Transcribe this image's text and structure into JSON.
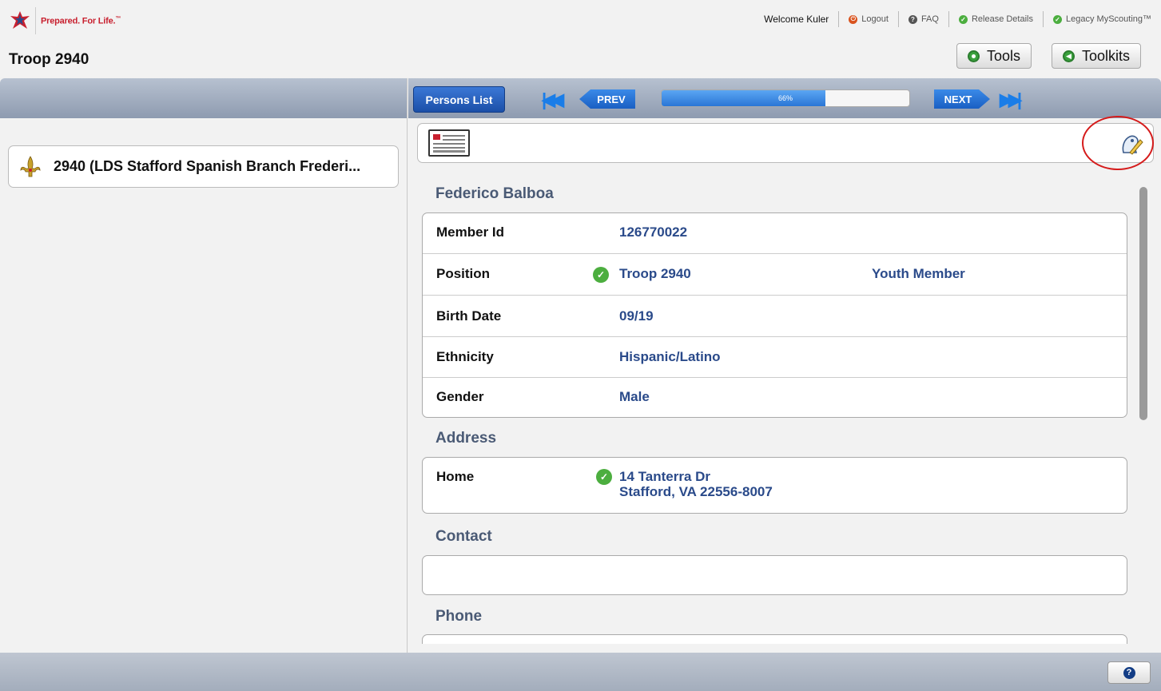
{
  "header": {
    "tagline": "Prepared. For Life.",
    "tagline_tm": "™",
    "unit_title": "Troop 2940",
    "welcome": "Welcome Kuler",
    "links": {
      "logout": "Logout",
      "faq": "FAQ",
      "release": "Release Details",
      "legacy": "Legacy MyScouting™"
    },
    "tools_label": "Tools",
    "toolkits_label": "Toolkits"
  },
  "left_panel": {
    "unit_name": "2940 (LDS Stafford Spanish Branch Frederi..."
  },
  "toolbar": {
    "persons_list_label": "Persons List",
    "prev_label": "PREV",
    "next_label": "NEXT",
    "progress_text": "66%",
    "progress_value": 0.66
  },
  "person": {
    "name": "Federico Balboa",
    "details": {
      "member_id_label": "Member Id",
      "member_id": "126770022",
      "position_label": "Position",
      "position_unit": "Troop 2940",
      "position_role": "Youth Member",
      "birth_label": "Birth Date",
      "birth": "09/19",
      "ethnicity_label": "Ethnicity",
      "ethnicity": "Hispanic/Latino",
      "gender_label": "Gender",
      "gender": "Male"
    },
    "address_title": "Address",
    "address": {
      "label": "Home",
      "line1": "14 Tanterra Dr",
      "line2": "Stafford, VA 22556-8007"
    },
    "contact_title": "Contact",
    "phone_title": "Phone"
  },
  "colors": {
    "accent": "#1b4fa8",
    "brand_red": "#c8202f",
    "check_green": "#4cae3f",
    "highlight_ring": "#d51b1b"
  },
  "icons": [
    "bsa-logo-icon",
    "logout-icon",
    "faq-icon",
    "check-icon",
    "home-icon",
    "back-icon",
    "id-card-icon",
    "edit-profile-icon",
    "help-icon",
    "first-page-icon",
    "last-page-icon"
  ]
}
